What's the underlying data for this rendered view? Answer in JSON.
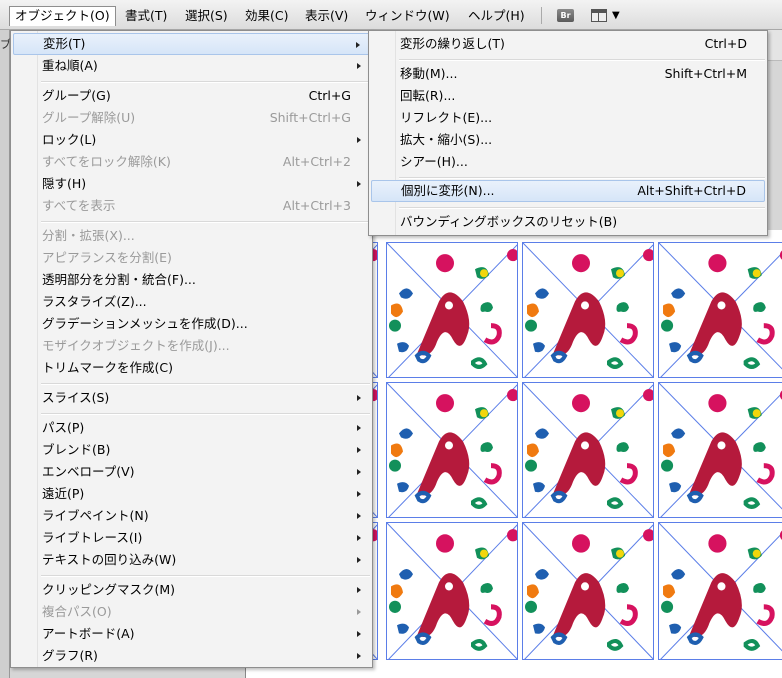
{
  "menubar": {
    "items": [
      {
        "label": "オブジェクト(O)",
        "active": true
      },
      {
        "label": "書式(T)"
      },
      {
        "label": "選択(S)"
      },
      {
        "label": "効果(C)"
      },
      {
        "label": "表示(V)"
      },
      {
        "label": "ウィンドウ(W)"
      },
      {
        "label": "ヘルプ(H)"
      }
    ],
    "bridge_label": "Br"
  },
  "doc_edge_glyph": "ブ",
  "object_menu": {
    "items": [
      {
        "label": "変形(T)",
        "shortcut": "",
        "submenu": true,
        "highlighted": true
      },
      {
        "label": "重ね順(A)",
        "shortcut": "",
        "submenu": true
      },
      {
        "label": "グループ(G)",
        "shortcut": "Ctrl+G"
      },
      {
        "label": "グループ解除(U)",
        "shortcut": "Shift+Ctrl+G",
        "disabled": true
      },
      {
        "label": "ロック(L)",
        "shortcut": "",
        "submenu": true
      },
      {
        "label": "すべてをロック解除(K)",
        "shortcut": "Alt+Ctrl+2",
        "disabled": true
      },
      {
        "label": "隠す(H)",
        "shortcut": "",
        "submenu": true
      },
      {
        "label": "すべてを表示",
        "shortcut": "Alt+Ctrl+3",
        "disabled": true
      },
      {
        "label": "分割・拡張(X)...",
        "shortcut": "",
        "disabled": true
      },
      {
        "label": "アピアランスを分割(E)",
        "shortcut": "",
        "disabled": true
      },
      {
        "label": "透明部分を分割・統合(F)...",
        "shortcut": ""
      },
      {
        "label": "ラスタライズ(Z)...",
        "shortcut": ""
      },
      {
        "label": "グラデーションメッシュを作成(D)...",
        "shortcut": ""
      },
      {
        "label": "モザイクオブジェクトを作成(J)...",
        "shortcut": "",
        "disabled": true
      },
      {
        "label": "トリムマークを作成(C)",
        "shortcut": ""
      },
      {
        "label": "スライス(S)",
        "shortcut": "",
        "submenu": true
      },
      {
        "label": "パス(P)",
        "shortcut": "",
        "submenu": true
      },
      {
        "label": "ブレンド(B)",
        "shortcut": "",
        "submenu": true
      },
      {
        "label": "エンベロープ(V)",
        "shortcut": "",
        "submenu": true
      },
      {
        "label": "遠近(P)",
        "shortcut": "",
        "submenu": true
      },
      {
        "label": "ライブペイント(N)",
        "shortcut": "",
        "submenu": true
      },
      {
        "label": "ライブトレース(I)",
        "shortcut": "",
        "submenu": true
      },
      {
        "label": "テキストの回り込み(W)",
        "shortcut": "",
        "submenu": true
      },
      {
        "label": "クリッピングマスク(M)",
        "shortcut": "",
        "submenu": true
      },
      {
        "label": "複合パス(O)",
        "shortcut": "",
        "submenu": true,
        "disabled": true
      },
      {
        "label": "アートボード(A)",
        "shortcut": "",
        "submenu": true
      },
      {
        "label": "グラフ(R)",
        "shortcut": "",
        "submenu": true
      }
    ]
  },
  "transform_submenu": {
    "items": [
      {
        "label": "変形の繰り返し(T)",
        "shortcut": "Ctrl+D"
      },
      {
        "label": "移動(M)...",
        "shortcut": "Shift+Ctrl+M"
      },
      {
        "label": "回転(R)...",
        "shortcut": ""
      },
      {
        "label": "リフレクト(E)...",
        "shortcut": ""
      },
      {
        "label": "拡大・縮小(S)...",
        "shortcut": ""
      },
      {
        "label": "シアー(H)...",
        "shortcut": ""
      },
      {
        "label": "個別に変形(N)...",
        "shortcut": "Alt+Shift+Ctrl+D",
        "highlighted": true
      },
      {
        "label": "バウンディングボックスのリセット(B)",
        "shortcut": ""
      }
    ]
  },
  "colors": {
    "selection_blue": "#5b7ee8",
    "magenta": "#d6125f",
    "crimson": "#b51a3c",
    "blue": "#1f5fb0",
    "green": "#12905a",
    "yellow": "#f2d60c",
    "orange": "#f07a10"
  }
}
